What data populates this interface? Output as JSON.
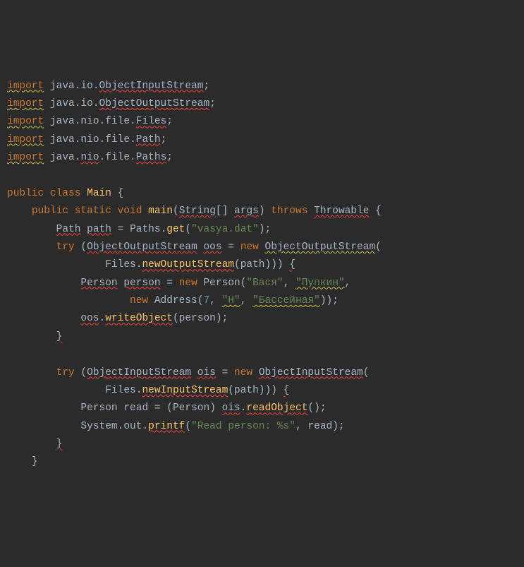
{
  "lines": {
    "l1_import": "import",
    "l1_pkg": " java.io.",
    "l1_cls": "ObjectInputStream",
    "l1_semi": ";",
    "l2_import": "import",
    "l2_pkg": " java.io.",
    "l2_cls": "ObjectOutputStream",
    "l2_semi": ";",
    "l3_import": "import",
    "l3_pkg": " java.nio.file.",
    "l3_cls": "Files",
    "l3_semi": ";",
    "l4_import": "import",
    "l4_pkg": " java.nio.file.",
    "l4_cls": "Path",
    "l4_semi": ";",
    "l5_import": "import",
    "l5_pkg": " java.",
    "l5_nio": "nio",
    "l5_rest": ".file.",
    "l5_cls": "Paths",
    "l5_semi": ";",
    "l7_public": "public",
    "l7_class": " class ",
    "l7_name": "Main",
    "l7_brace": " {",
    "l8_indent": "    ",
    "l8_public": "public",
    "l8_static": " static ",
    "l8_void": "void",
    "l8_sp": " ",
    "l8_main": "main",
    "l8_open": "(",
    "l8_string": "String",
    "l8_arr": "[] ",
    "l8_args": "args",
    "l8_close": ") ",
    "l8_throws": "throws",
    "l8_sp2": " ",
    "l8_throwable": "Throwable",
    "l8_brace": " {",
    "l9_indent": "        ",
    "l9_path_t": "Path",
    "l9_sp": " ",
    "l9_path_v": "path",
    "l9_eq": " = ",
    "l9_paths": "Paths",
    "l9_dot": ".",
    "l9_get": "get",
    "l9_open": "(",
    "l9_str": "\"vasya.dat\"",
    "l9_close": ");",
    "l10_indent": "        ",
    "l10_try": "try",
    "l10_sp": " (",
    "l10_oos_t": "ObjectOutputStream",
    "l10_sp2": " ",
    "l10_oos_v": "oos",
    "l10_eq": " = ",
    "l10_new": "new",
    "l10_sp3": " ",
    "l10_oos_t2": "ObjectOutputStream",
    "l10_open": "(",
    "l11_indent": "                ",
    "l11_files": "Files",
    "l11_dot": ".",
    "l11_nout": "newOutputStream",
    "l11_open": "(",
    "l11_path": "path",
    "l11_close": "))) ",
    "l11_brace": "{",
    "l12_indent": "            ",
    "l12_person_t": "Person",
    "l12_sp": " ",
    "l12_person_v": "person",
    "l12_eq": " = ",
    "l12_new": "new",
    "l12_sp2": " ",
    "l12_person_t2": "Person",
    "l12_open": "(",
    "l12_s1": "\"Вася\"",
    "l12_c1": ", ",
    "l12_s2": "\"Пупкин\"",
    "l12_c2": ",",
    "l13_indent": "                    ",
    "l13_new": "new",
    "l13_sp": " ",
    "l13_addr": "Address",
    "l13_open": "(",
    "l13_n": "7",
    "l13_c1": ", ",
    "l13_s1": "\"Н\"",
    "l13_c2": ", ",
    "l13_s2": "\"Бассейная\"",
    "l13_close": "));",
    "l14_indent": "            ",
    "l14_oos": "oos",
    "l14_dot": ".",
    "l14_wo": "writeObject",
    "l14_open": "(",
    "l14_person": "person",
    "l14_close": ");",
    "l15_indent": "        ",
    "l15_brace": "}",
    "l17_indent": "        ",
    "l17_try": "try",
    "l17_sp": " (",
    "l17_ois_t": "ObjectInputStream",
    "l17_sp2": " ",
    "l17_ois_v": "ois",
    "l17_eq": " = ",
    "l17_new": "new",
    "l17_sp3": " ",
    "l17_ois_t2": "ObjectInputStream",
    "l17_open": "(",
    "l18_indent": "                ",
    "l18_files": "Files",
    "l18_dot": ".",
    "l18_nin": "newInputStream",
    "l18_open": "(",
    "l18_path": "path",
    "l18_close": "))) ",
    "l18_brace": "{",
    "l19_indent": "            ",
    "l19_person_t": "Person",
    "l19_sp": " ",
    "l19_read": "read",
    "l19_eq": " = (",
    "l19_person_t2": "Person",
    "l19_cast": ") ",
    "l19_ois": "ois",
    "l19_dot": ".",
    "l19_ro": "readObject",
    "l19_close": "();",
    "l20_indent": "            ",
    "l20_sys": "System",
    "l20_dot": ".",
    "l20_out": "out",
    "l20_dot2": ".",
    "l20_printf": "printf",
    "l20_open": "(",
    "l20_str": "\"Read person: %s\"",
    "l20_c": ", ",
    "l20_read": "read",
    "l20_close": ");",
    "l21_indent": "        ",
    "l21_brace": "}",
    "l22_indent": "    ",
    "l22_brace": "}"
  }
}
